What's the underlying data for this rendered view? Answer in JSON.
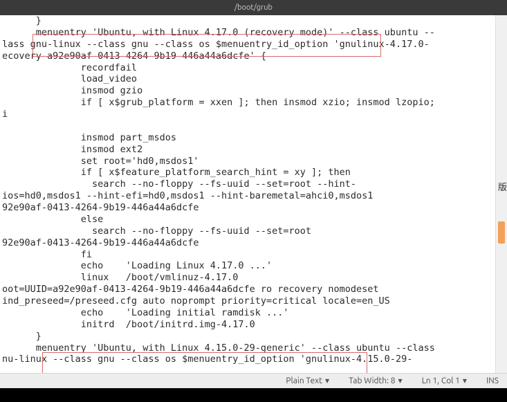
{
  "titlebar": {
    "path": "/boot/grub"
  },
  "code": {
    "text": "      }\n      menuentry 'Ubuntu, with Linux 4.17.0 (recovery mode)' --class ubuntu --\nlass gnu-linux --class gnu --class os $menuentry_id_option 'gnulinux-4.17.0-\necovery-a92e90af-0413-4264-9b19-446a44a6dcfe' {\n              recordfail\n              load_video\n              insmod gzio\n              if [ x$grub_platform = xxen ]; then insmod xzio; insmod lzopio;\ni\n\n              insmod part_msdos\n              insmod ext2\n              set root='hd0,msdos1'\n              if [ x$feature_platform_search_hint = xy ]; then\n                search --no-floppy --fs-uuid --set=root --hint-\nios=hd0,msdos1 --hint-efi=hd0,msdos1 --hint-baremetal=ahci0,msdos1\n92e90af-0413-4264-9b19-446a44a6dcfe\n              else\n                search --no-floppy --fs-uuid --set=root\n92e90af-0413-4264-9b19-446a44a6dcfe\n              fi\n              echo    'Loading Linux 4.17.0 ...'\n              linux   /boot/vmlinuz-4.17.0\noot=UUID=a92e90af-0413-4264-9b19-446a44a6dcfe ro recovery nomodeset\nind_preseed=/preseed.cfg auto noprompt priority=critical locale=en_US\n              echo    'Loading initial ramdisk ...'\n              initrd  /boot/initrd.img-4.17.0\n      }\n      menuentry 'Ubuntu, with Linux 4.15.0-29-generic' --class ubuntu --class\nnu-linux --class gnu --class os $menuentry_id_option 'gnulinux-4.15.0-29-"
  },
  "statusbar": {
    "syntax": "Plain Text",
    "tabwidth_label": "Tab Width: 8",
    "position": "Ln 1, Col 1",
    "mode": "INS"
  },
  "side_char": "版"
}
